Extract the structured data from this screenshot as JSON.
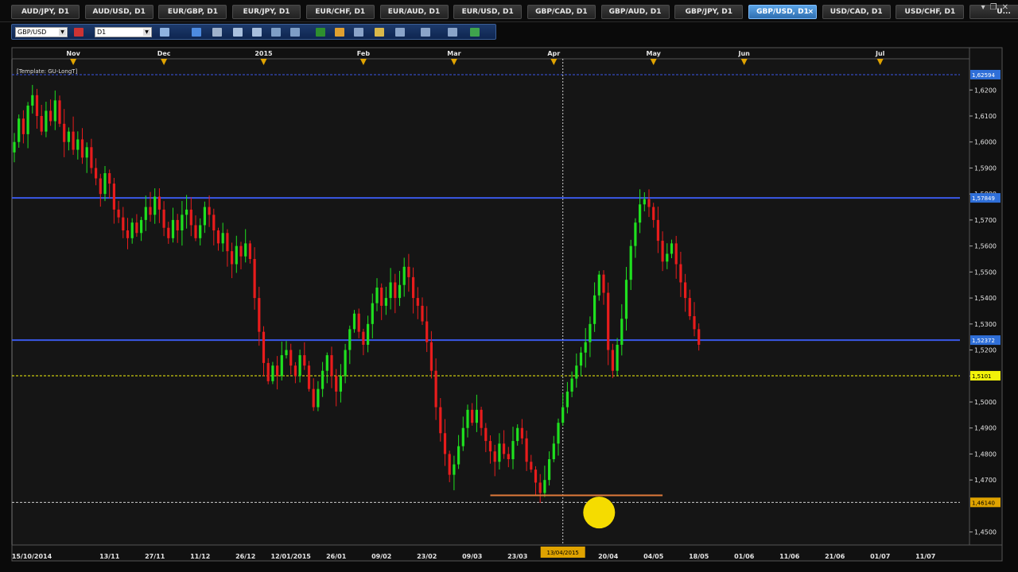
{
  "tabs": [
    {
      "label": "AUD/JPY, D1"
    },
    {
      "label": "AUD/USD, D1"
    },
    {
      "label": "EUR/GBP, D1"
    },
    {
      "label": "EUR/JPY, D1"
    },
    {
      "label": "EUR/CHF, D1"
    },
    {
      "label": "EUR/AUD, D1"
    },
    {
      "label": "EUR/USD, D1"
    },
    {
      "label": "GBP/CAD, D1"
    },
    {
      "label": "GBP/AUD, D1"
    },
    {
      "label": "GBP/JPY, D1"
    },
    {
      "label": "GBP/USD, D1",
      "active": true
    },
    {
      "label": "USD/CAD, D1"
    },
    {
      "label": "USD/CHF, D1"
    },
    {
      "label": "U..."
    }
  ],
  "tab_close_glyph": "×",
  "toolbar": {
    "symbol": "GBP/USD",
    "timeframe": "D1"
  },
  "template_label": "[Template: GU-LongT]",
  "colors": {
    "bull": "#1fe01f",
    "bear": "#e81c1c",
    "level_blue": "#3a58e8",
    "level_yellow": "#f2f20a",
    "marker": "#f5dc00",
    "grid": "#555555",
    "bg": "#151515"
  },
  "chart_data": {
    "type": "candlestick",
    "symbol": "GBP/USD",
    "timeframe": "D1",
    "ylim": [
      1.445,
      1.632
    ],
    "y_ticks": [
      "1,6200",
      "1,6100",
      "1,6000",
      "1,5900",
      "1,5800",
      "1,5700",
      "1,5600",
      "1,5500",
      "1,5400",
      "1,5300",
      "1,5200",
      "1,5100",
      "1,5000",
      "1,4900",
      "1,4800",
      "1,4700",
      "1,4500"
    ],
    "y_tick_values": [
      1.62,
      1.61,
      1.6,
      1.59,
      1.58,
      1.57,
      1.56,
      1.55,
      1.54,
      1.53,
      1.52,
      1.51,
      1.5,
      1.49,
      1.48,
      1.47,
      1.45
    ],
    "date_labels": [
      "15/10/2014",
      "13/11",
      "27/11",
      "11/12",
      "26/12",
      "12/01/2015",
      "26/01",
      "09/02",
      "23/02",
      "09/03",
      "23/03",
      "20/04",
      "04/05",
      "18/05",
      "01/06",
      "11/06",
      "21/06",
      "01/07",
      "11/07"
    ],
    "date_label_index": [
      0,
      21,
      31,
      41,
      51,
      61,
      71,
      81,
      91,
      101,
      111,
      131,
      141,
      151,
      161,
      171,
      181,
      191,
      201
    ],
    "month_labels": [
      "Nov",
      "Dec",
      "2015",
      "Feb",
      "Mar",
      "Apr",
      "May",
      "Jun",
      "Jul"
    ],
    "month_label_index": [
      13,
      33,
      55,
      77,
      97,
      119,
      141,
      161,
      191
    ],
    "price_levels": [
      {
        "value": 1.6259,
        "label": "1,62594",
        "color": "blue",
        "style": "dashed"
      },
      {
        "value": 1.5785,
        "label": "1,57849",
        "color": "blue",
        "style": "solid"
      },
      {
        "value": 1.5238,
        "label": "1,52372",
        "color": "blue",
        "style": "solid"
      },
      {
        "value": 1.5101,
        "label": "1,5101",
        "color": "yellow",
        "style": "dashed"
      },
      {
        "value": 1.4614,
        "label": "1,46140",
        "color": "white",
        "style": "dashed"
      }
    ],
    "support_line": {
      "from_index": 105,
      "to_index": 143,
      "value": 1.4641
    },
    "crosshair_index": 121,
    "crosshair_label": "13/04/2015",
    "marker_index": 129,
    "marker_value": 1.4575,
    "last_index": 162,
    "closes": [
      1.6,
      1.609,
      1.603,
      1.614,
      1.618,
      1.61,
      1.604,
      1.612,
      1.608,
      1.616,
      1.607,
      1.6,
      1.604,
      1.597,
      1.601,
      1.594,
      1.598,
      1.59,
      1.586,
      1.58,
      1.588,
      1.584,
      1.574,
      1.571,
      1.566,
      1.563,
      1.569,
      1.565,
      1.57,
      1.575,
      1.572,
      1.579,
      1.574,
      1.567,
      1.563,
      1.57,
      1.566,
      1.572,
      1.574,
      1.568,
      1.563,
      1.568,
      1.575,
      1.572,
      1.566,
      1.561,
      1.565,
      1.558,
      1.553,
      1.56,
      1.556,
      1.561,
      1.555,
      1.54,
      1.527,
      1.515,
      1.508,
      1.514,
      1.51,
      1.518,
      1.52,
      1.514,
      1.51,
      1.518,
      1.514,
      1.505,
      1.498,
      1.505,
      1.512,
      1.518,
      1.51,
      1.504,
      1.51,
      1.52,
      1.528,
      1.534,
      1.527,
      1.522,
      1.53,
      1.538,
      1.544,
      1.537,
      1.54,
      1.546,
      1.54,
      1.545,
      1.552,
      1.548,
      1.54,
      1.537,
      1.531,
      1.523,
      1.512,
      1.498,
      1.488,
      1.48,
      1.472,
      1.476,
      1.483,
      1.49,
      1.497,
      1.492,
      1.497,
      1.49,
      1.485,
      1.481,
      1.477,
      1.484,
      1.48,
      1.478,
      1.485,
      1.49,
      1.486,
      1.477,
      1.474,
      1.469,
      1.465,
      1.47,
      1.478,
      1.484,
      1.492,
      1.498,
      1.504,
      1.509,
      1.514,
      1.519,
      1.523,
      1.53,
      1.541,
      1.549,
      1.542,
      1.52,
      1.512,
      1.522,
      1.532,
      1.547,
      1.56,
      1.569,
      1.576,
      1.578,
      1.575,
      1.57,
      1.562,
      1.554,
      1.557,
      1.561,
      1.553,
      1.546,
      1.54,
      1.533,
      1.528,
      1.522
    ]
  }
}
